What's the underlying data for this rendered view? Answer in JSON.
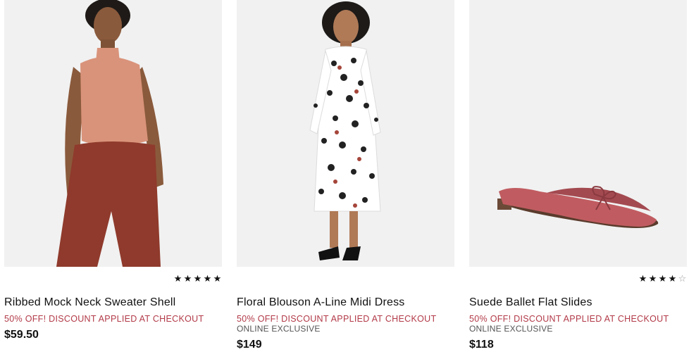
{
  "products": [
    {
      "image_alt": "Ribbed Mock Neck Sweater Shell",
      "rating_stars": 5,
      "name": "Ribbed Mock Neck Sweater Shell",
      "promo": "50% OFF! DISCOUNT APPLIED AT CHECKOUT",
      "badge": "",
      "price": "$59.50"
    },
    {
      "image_alt": "Floral Blouson A-Line Midi Dress",
      "rating_stars": null,
      "name": "Floral Blouson A-Line Midi Dress",
      "promo": "50% OFF! DISCOUNT APPLIED AT CHECKOUT",
      "badge": "ONLINE EXCLUSIVE",
      "price": "$149"
    },
    {
      "image_alt": "Suede Ballet Flat Slides",
      "rating_stars": 4,
      "name": "Suede Ballet Flat Slides",
      "promo": "50% OFF! DISCOUNT APPLIED AT CHECKOUT",
      "badge": "ONLINE EXCLUSIVE",
      "price": "$118"
    }
  ],
  "colors": {
    "promo": "#b23a48",
    "image_bg": "#f1f1f1",
    "star": "#111111"
  }
}
